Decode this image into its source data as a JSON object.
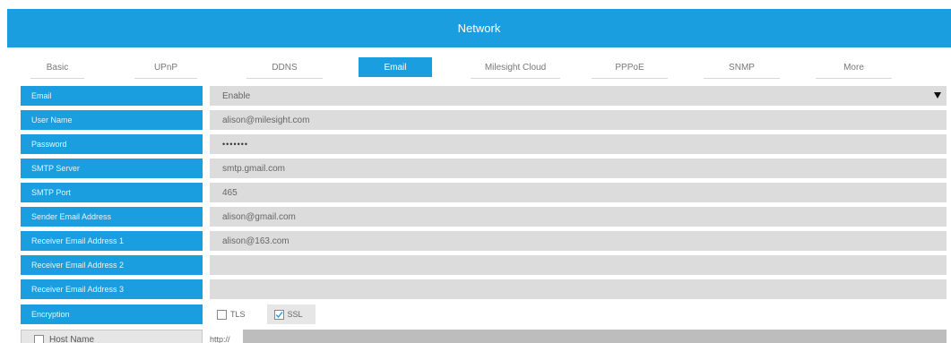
{
  "header": {
    "title": "Network"
  },
  "tabs": [
    {
      "label": "Basic"
    },
    {
      "label": "UPnP"
    },
    {
      "label": "DDNS"
    },
    {
      "label": "Email",
      "active": true
    },
    {
      "label": "Milesight Cloud"
    },
    {
      "label": "PPPoE"
    },
    {
      "label": "SNMP"
    },
    {
      "label": "More"
    }
  ],
  "form": {
    "email": {
      "label": "Email",
      "value": "Enable"
    },
    "user_name": {
      "label": "User Name",
      "value": "alison@milesight.com"
    },
    "password": {
      "label": "Password",
      "value": "•••••••"
    },
    "smtp_server": {
      "label": "SMTP Server",
      "value": "smtp.gmail.com"
    },
    "smtp_port": {
      "label": "SMTP Port",
      "value": "465"
    },
    "sender": {
      "label": "Sender Email Address",
      "value": "alison@gmail.com"
    },
    "receiver1": {
      "label": "Receiver Email Address 1",
      "value": "alison@163.com"
    },
    "receiver2": {
      "label": "Receiver Email Address 2",
      "value": ""
    },
    "receiver3": {
      "label": "Receiver Email Address 3",
      "value": ""
    },
    "encryption": {
      "label": "Encryption",
      "tls": {
        "label": "TLS",
        "checked": false
      },
      "ssl": {
        "label": "SSL",
        "checked": true
      }
    },
    "host_name": {
      "label": "Host Name",
      "checked": false,
      "prefix": "http://",
      "value": ""
    }
  },
  "colors": {
    "accent": "#1b9ee0",
    "field_bg": "#dcdcdc",
    "check": "#1b9ee0"
  }
}
